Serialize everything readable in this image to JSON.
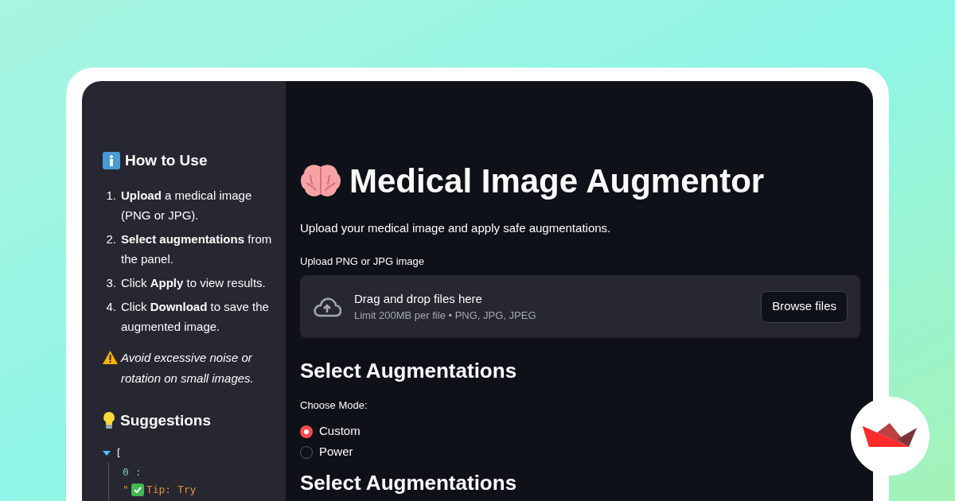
{
  "sidebar": {
    "how_to": {
      "title": "How to Use",
      "steps": [
        {
          "number": "1.",
          "text": "**Upload** a medical image (PNG or JPG)."
        },
        {
          "number": "2.",
          "text": "**Select augmentations** from the panel."
        },
        {
          "number": "3.",
          "text": "Click **Apply** to view results."
        },
        {
          "number": "4.",
          "text": "Click **Download** to save the augmented image."
        }
      ],
      "warning": "Avoid excessive noise or rotation on small images."
    },
    "suggestions": {
      "title": "Suggestions",
      "json_viewer": {
        "expanded": true,
        "open_bracket": "[",
        "index": "0 :",
        "value_start": "\"",
        "value": "Tip: Try"
      }
    }
  },
  "main": {
    "title": "Medical Image Augmentor",
    "subtitle": "Upload your medical image and apply safe augmentations.",
    "uploader": {
      "label": "Upload PNG or JPG image",
      "drop_text": "Drag and drop files here",
      "limit_text": "Limit 200MB per file • PNG, JPG, JPEG",
      "button": "Browse files"
    },
    "section_title": "Select Augmentations",
    "mode": {
      "label": "Choose Mode:",
      "options": [
        {
          "label": "Custom",
          "selected": true
        },
        {
          "label": "Power",
          "selected": false
        }
      ]
    },
    "next_section_title": "Select Augmentations"
  }
}
